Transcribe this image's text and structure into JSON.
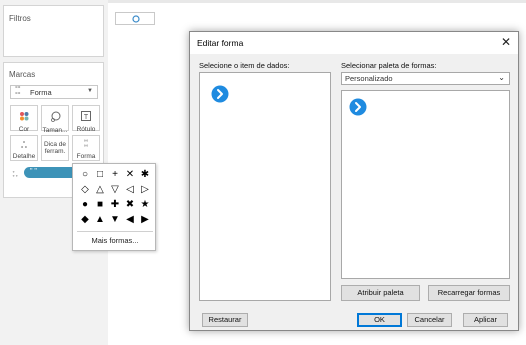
{
  "left_panel": {
    "filters_title": "Filtros",
    "marks_title": "Marcas",
    "mark_type": {
      "icon": "shapes-icon",
      "label": "Forma"
    },
    "cards": [
      {
        "name": "color",
        "icon": "color-dots-icon",
        "label": "Cor"
      },
      {
        "name": "size",
        "icon": "size-icon",
        "label": "Taman..."
      },
      {
        "name": "label",
        "icon": "text-label-icon",
        "label": "Rótulo"
      },
      {
        "name": "detail",
        "icon": "detail-dots-icon",
        "label": "Detalhe"
      },
      {
        "name": "tooltip",
        "icon": "tooltip-icon",
        "label": "Dica de ferram."
      },
      {
        "name": "shape",
        "icon": "shapes-icon",
        "label": "Forma"
      }
    ],
    "pill_text": "\" \""
  },
  "shape_popup": {
    "rows": [
      [
        "○",
        "□",
        "+",
        "✕",
        "✱"
      ],
      [
        "◇",
        "△",
        "▽",
        "◁",
        "▷"
      ],
      [
        "●",
        "■",
        "✚",
        "✖",
        "★"
      ],
      [
        "◆",
        "▲",
        "▼",
        "◀",
        "▶"
      ]
    ],
    "more_label": "Mais formas..."
  },
  "dialog": {
    "title": "Editar forma",
    "close_icon": "close-icon",
    "data_items_label": "Selecione o item de dados:",
    "palette_label": "Selecionar paleta de formas:",
    "palette_value": "Personalizado",
    "assign_palette": "Atribuir paleta",
    "reload_shapes": "Recarregar formas",
    "restore": "Restaurar",
    "ok": "OK",
    "cancel": "Cancelar",
    "apply": "Aplicar",
    "accent_color": "#0078d7"
  }
}
